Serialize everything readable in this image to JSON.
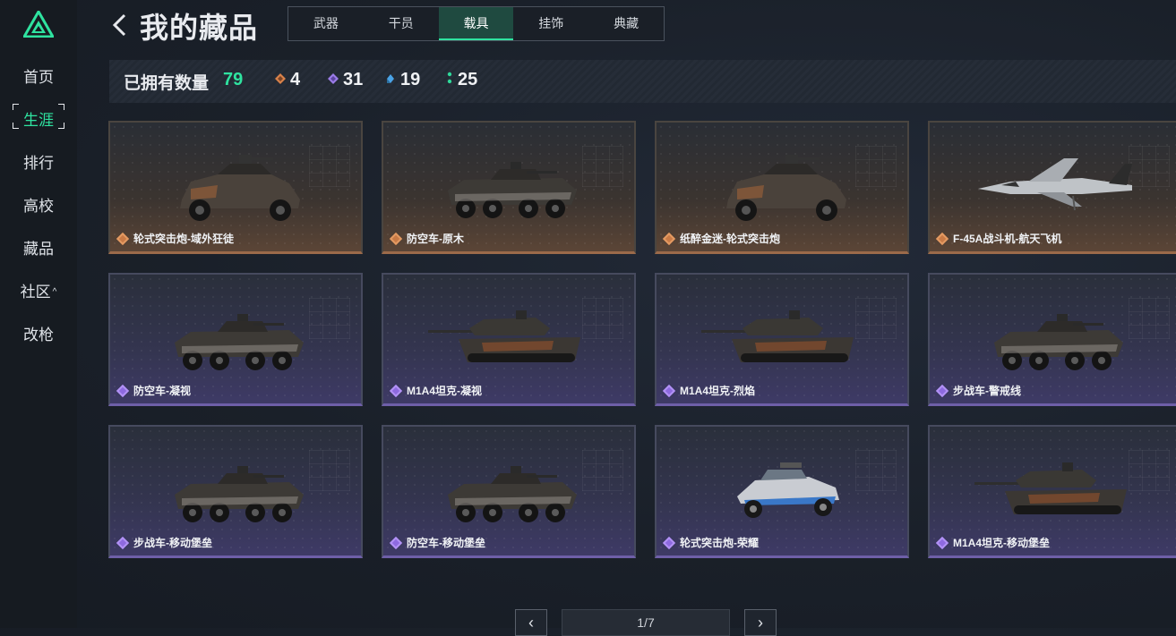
{
  "sidebar": {
    "items": [
      {
        "label": "首页"
      },
      {
        "label": "生涯",
        "active": true
      },
      {
        "label": "排行"
      },
      {
        "label": "高校"
      },
      {
        "label": "藏品"
      },
      {
        "label": "社区",
        "caret": "^"
      },
      {
        "label": "改枪"
      }
    ]
  },
  "header": {
    "title": "我的藏品",
    "tabs": [
      {
        "label": "武器"
      },
      {
        "label": "干员"
      },
      {
        "label": "载具",
        "active": true
      },
      {
        "label": "挂饰"
      },
      {
        "label": "典藏"
      }
    ]
  },
  "stats": {
    "owned_label": "已拥有数量",
    "owned_total": "79",
    "counts": [
      {
        "rarity": "orange",
        "color": "#d9824a",
        "value": "4"
      },
      {
        "rarity": "purple",
        "color": "#9b7ce8",
        "value": "31"
      },
      {
        "rarity": "blue",
        "color": "#4aa3e6",
        "value": "19"
      },
      {
        "rarity": "green",
        "color": "#2fd99a",
        "value": "25"
      }
    ]
  },
  "cards": [
    {
      "name": "轮式突击炮-域外狂徒",
      "rarity": "legend",
      "vehicle": "armored-car"
    },
    {
      "name": "防空车-原木",
      "rarity": "legend",
      "vehicle": "apc"
    },
    {
      "name": "纸醉金迷-轮式突击炮",
      "rarity": "legend",
      "vehicle": "armored-car"
    },
    {
      "name": "F-45A战斗机-航天飞机",
      "rarity": "legend",
      "vehicle": "jet"
    },
    {
      "name": "防空车-凝视",
      "rarity": "epic",
      "vehicle": "apc"
    },
    {
      "name": "M1A4坦克-凝视",
      "rarity": "epic",
      "vehicle": "tank"
    },
    {
      "name": "M1A4坦克-烈焰",
      "rarity": "epic",
      "vehicle": "tank"
    },
    {
      "name": "步战车-警戒线",
      "rarity": "epic",
      "vehicle": "apc"
    },
    {
      "name": "步战车-移动堡垒",
      "rarity": "epic",
      "vehicle": "apc"
    },
    {
      "name": "防空车-移动堡垒",
      "rarity": "epic",
      "vehicle": "apc"
    },
    {
      "name": "轮式突击炮-荣耀",
      "rarity": "epic",
      "vehicle": "buggy"
    },
    {
      "name": "M1A4坦克-移动堡垒",
      "rarity": "epic",
      "vehicle": "tank"
    }
  ],
  "pagination": {
    "indicator": "1/7",
    "prev": "‹",
    "next": "›"
  }
}
